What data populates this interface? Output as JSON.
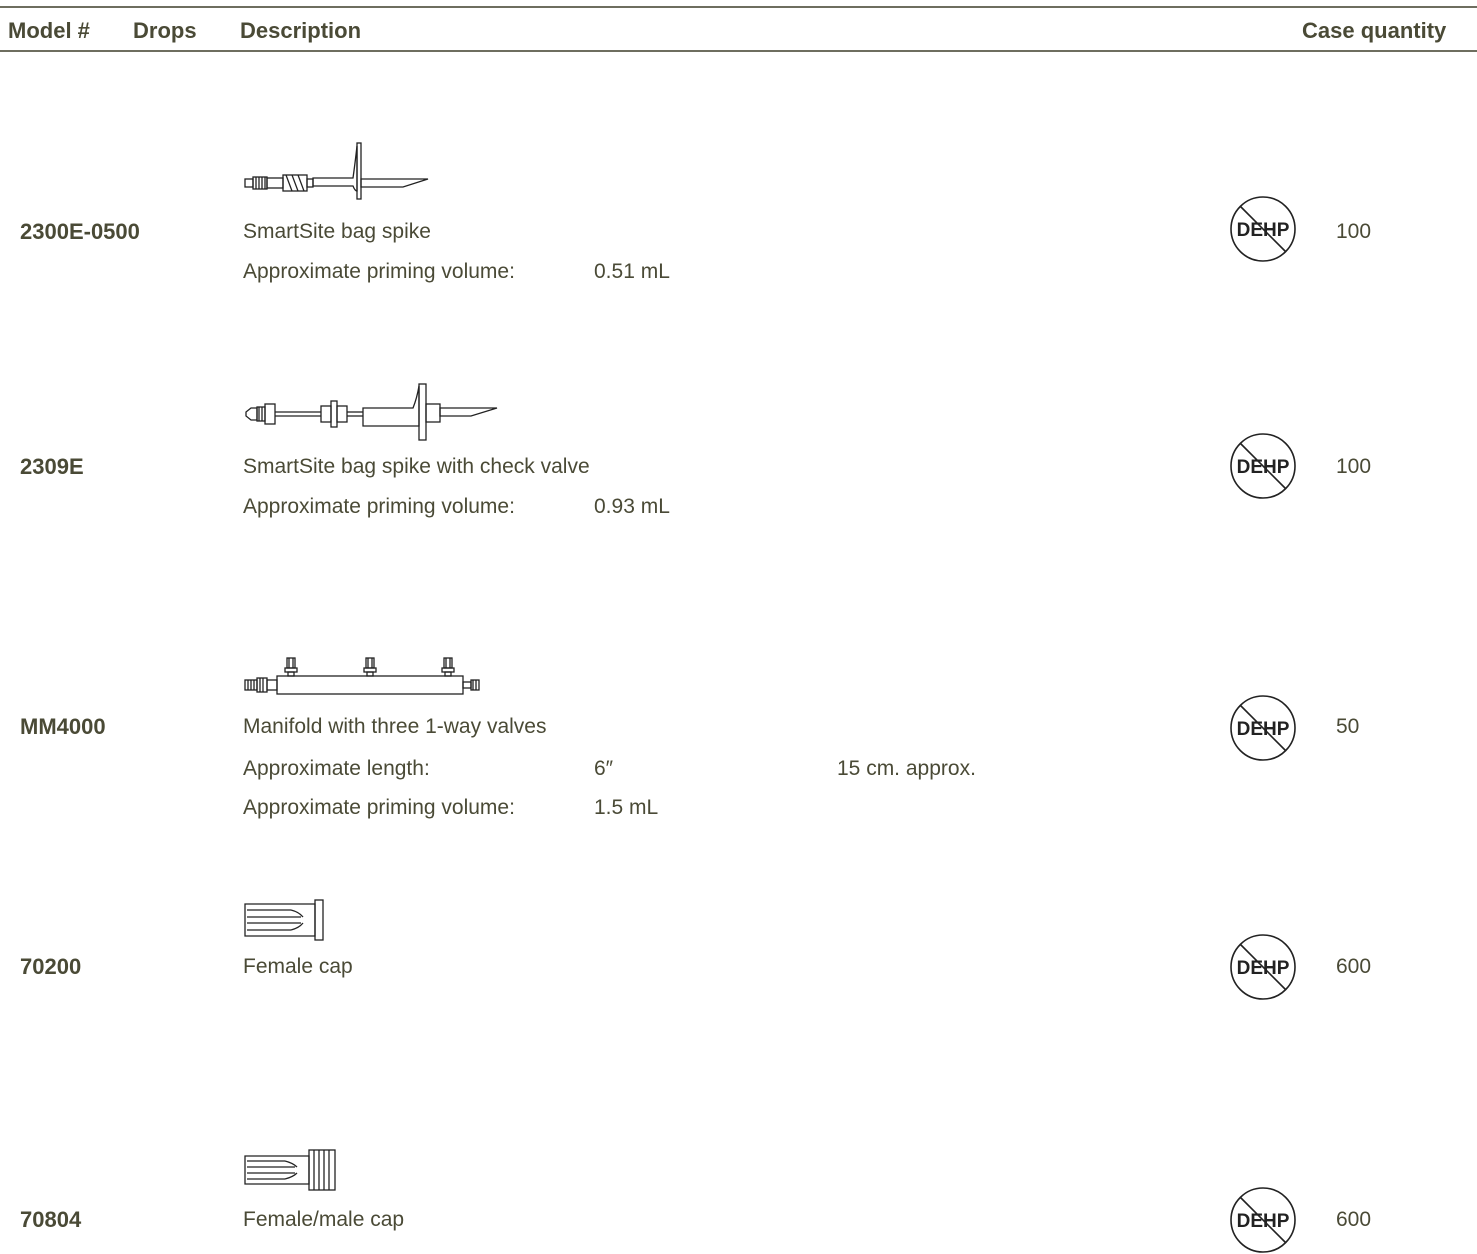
{
  "header": {
    "model": "Model #",
    "drops": "Drops",
    "description": "Description",
    "case_quantity": "Case quantity"
  },
  "badge_text": "DEHP",
  "products": [
    {
      "model": "2300E-0500",
      "description": "SmartSite bag spike",
      "specs": [
        {
          "label": "Approximate priming volume:",
          "value": "0.51 mL",
          "extra": ""
        }
      ],
      "case_quantity": "100",
      "icon": "bag-spike-icon"
    },
    {
      "model": "2309E",
      "description": "SmartSite bag spike with check valve",
      "specs": [
        {
          "label": "Approximate priming volume:",
          "value": "0.93 mL",
          "extra": ""
        }
      ],
      "case_quantity": "100",
      "icon": "bag-spike-check-valve-icon"
    },
    {
      "model": "MM4000",
      "description": "Manifold with three 1-way valves",
      "specs": [
        {
          "label": "Approximate length:",
          "value": "6″",
          "extra": "15 cm. approx."
        },
        {
          "label": "Approximate priming volume:",
          "value": "1.5 mL",
          "extra": ""
        }
      ],
      "case_quantity": "50",
      "icon": "manifold-icon"
    },
    {
      "model": "70200",
      "description": "Female cap",
      "specs": [],
      "case_quantity": "600",
      "icon": "female-cap-icon"
    },
    {
      "model": "70804",
      "description": "Female/male cap",
      "specs": [],
      "case_quantity": "600",
      "icon": "female-male-cap-icon"
    }
  ]
}
